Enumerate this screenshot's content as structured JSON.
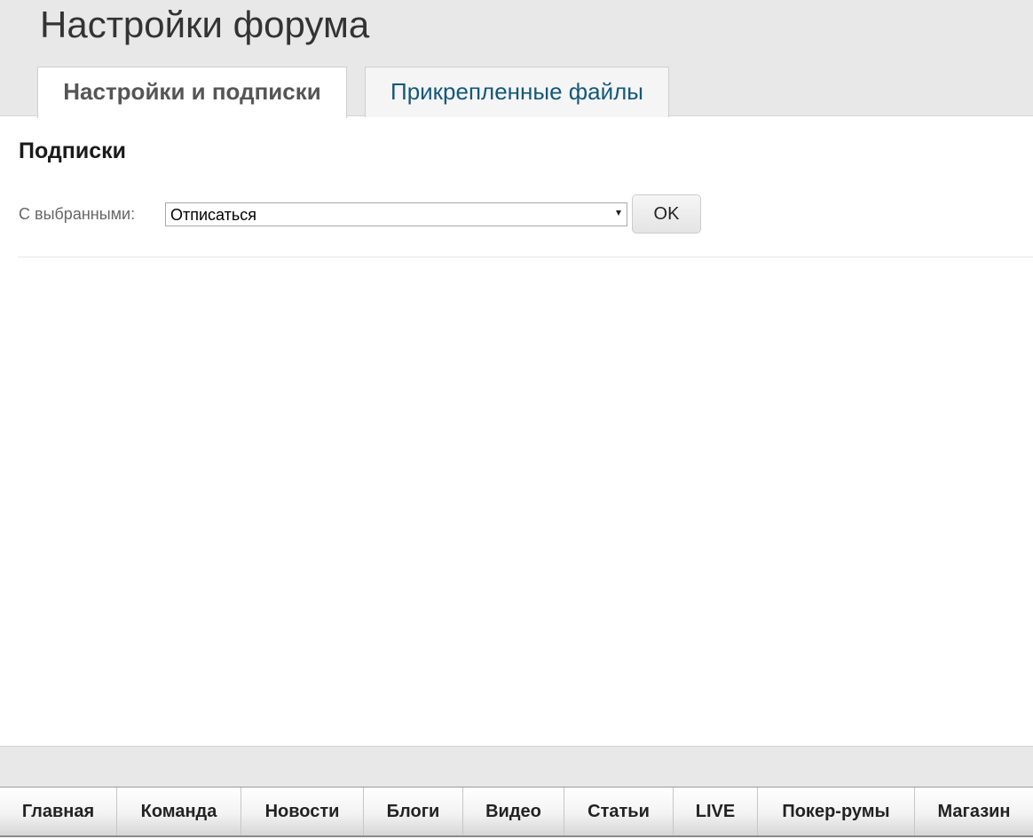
{
  "header": {
    "title": "Настройки форума",
    "tabs": [
      {
        "label": "Настройки и подписки",
        "active": true
      },
      {
        "label": "Прикрепленные файлы",
        "active": false
      }
    ]
  },
  "content": {
    "section_heading": "Подписки",
    "action_label": "С выбранными:",
    "action_select": {
      "selected": "Отписаться"
    },
    "ok_label": "OK"
  },
  "bottom_nav": {
    "items": [
      "Главная",
      "Команда",
      "Новости",
      "Блоги",
      "Видео",
      "Статьи",
      "LIVE",
      "Покер-румы",
      "Магазин"
    ]
  },
  "colors": {
    "header_bg": "#e8e8e8",
    "active_tab_text": "#555555",
    "inactive_tab_text": "#14587a",
    "label_text": "#666666"
  },
  "icons": [
    "chevron-down-icon"
  ]
}
